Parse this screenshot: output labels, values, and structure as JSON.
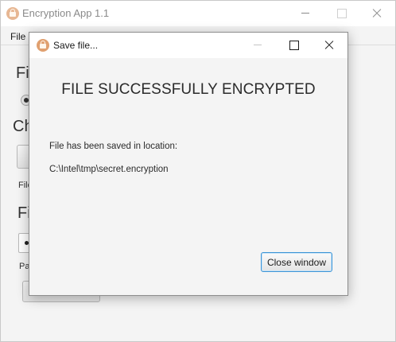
{
  "main_window": {
    "title": "Encryption App 1.1",
    "menu": {
      "file_label": "File"
    },
    "background_fragments": {
      "heading_1": "Fi",
      "heading_2": "Ch",
      "small_1": "File",
      "heading_3": "Fi",
      "small_2": "Pa"
    }
  },
  "dialog": {
    "title": "Save file...",
    "heading": "FILE SUCCESSFULLY ENCRYPTED",
    "saved_label": "File has been saved in location:",
    "saved_path": "C:\\Intel\\tmp\\secret.encryption",
    "close_button_label": "Close window"
  },
  "icons": {
    "app_icon": "lock-icon",
    "minimize": "minimize-icon",
    "maximize": "maximize-icon",
    "close": "close-icon"
  },
  "colors": {
    "focus_border": "#3d95d6",
    "app_icon": "#e0a070"
  }
}
